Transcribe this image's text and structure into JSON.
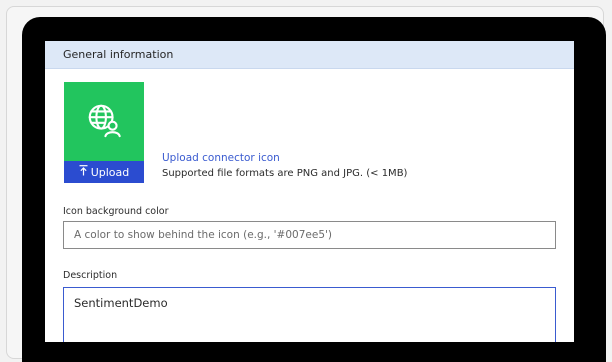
{
  "section": {
    "title": "General information"
  },
  "icon_upload": {
    "icon_name": "globe-with-user-icon",
    "background_color": "#22c55e",
    "upload_button_label": "Upload",
    "upload_link_text": "Upload connector icon",
    "hint_text": "Supported file formats are PNG and JPG. (< 1MB)"
  },
  "icon_background": {
    "label": "Icon background color",
    "value": "",
    "placeholder": "A color to show behind the icon (e.g., '#007ee5')"
  },
  "description": {
    "label": "Description",
    "value": "SentimentDemo"
  },
  "colors": {
    "header_bg": "#dde8f7",
    "accent_blue": "#2b4cd0",
    "icon_green": "#22c55e"
  }
}
